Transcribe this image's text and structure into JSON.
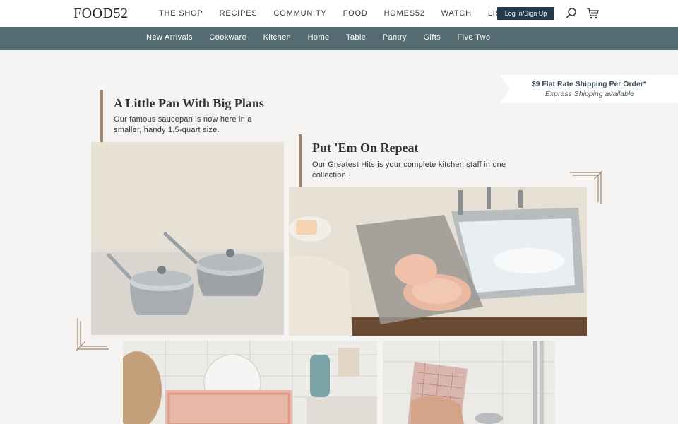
{
  "brand": {
    "logo_text": "FOOD52"
  },
  "top_nav": {
    "items": [
      "THE SHOP",
      "RECIPES",
      "COMMUNITY",
      "FOOD",
      "HOMES52",
      "WATCH",
      "LISTEN"
    ],
    "login_label": "Log In/Sign Up",
    "search_icon": "search-icon",
    "cart_icon": "cart-icon"
  },
  "sub_nav": {
    "items": [
      "New Arrivals",
      "Cookware",
      "Kitchen",
      "Home",
      "Table",
      "Pantry",
      "Gifts",
      "Five Two"
    ]
  },
  "shipping": {
    "main": "$9 Flat Rate Shipping Per Order*",
    "sub": "Express Shipping available"
  },
  "features": [
    {
      "title": "A Little Pan With Big Plans",
      "desc": "Our famous saucepan is now here in a smaller, handy 1.5-quart size."
    },
    {
      "title": "Put 'Em On Repeat",
      "desc": "Our Greatest Hits is your complete kitchen staff in one collection."
    }
  ],
  "colors": {
    "accent_bar": "#a0866f",
    "subnav_bg": "#546b72",
    "login_bg": "#24394a"
  }
}
